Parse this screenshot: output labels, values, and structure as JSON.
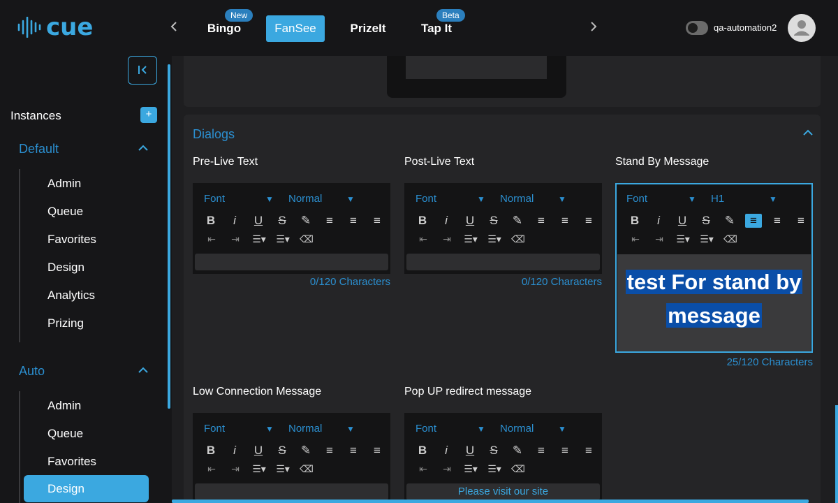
{
  "app": {
    "logo_text": "cue"
  },
  "header": {
    "tabs": [
      {
        "label": "Bingo",
        "badge": "New"
      },
      {
        "label": "FanSee",
        "badge": ""
      },
      {
        "label": "PrizeIt",
        "badge": ""
      },
      {
        "label": "Tap It",
        "badge": "Beta"
      }
    ],
    "active_tab": "FanSee",
    "username": "qa-automation2",
    "prev_icon": "chevron-left-icon",
    "next_icon": "chevron-right-icon"
  },
  "sidebar": {
    "instances_label": "Instances",
    "groups": [
      {
        "name": "Default",
        "items": [
          "Admin",
          "Queue",
          "Favorites",
          "Design",
          "Analytics",
          "Prizing"
        ]
      },
      {
        "name": "Auto",
        "items": [
          "Admin",
          "Queue",
          "Favorites",
          "Design"
        ]
      }
    ],
    "active_item": "Design"
  },
  "dialogs": {
    "title": "Dialogs",
    "fields": [
      {
        "label": "Pre-Live Text",
        "font": "Font",
        "size": "Normal",
        "counter": "0/120 Characters",
        "content": ""
      },
      {
        "label": "Post-Live Text",
        "font": "Font",
        "size": "Normal",
        "counter": "0/120 Characters",
        "content": ""
      },
      {
        "label": "Stand By Message",
        "font": "Font",
        "size": "H1",
        "counter": "25/120 Characters",
        "content_line1": "test For stand by",
        "content_line2": "message"
      },
      {
        "label": "Low Connection Message",
        "font": "Font",
        "size": "Normal",
        "counter": "",
        "content": ""
      },
      {
        "label": "Pop UP redirect message",
        "font": "Font",
        "size": "Normal",
        "counter": "",
        "content": "Please visit our site"
      }
    ]
  },
  "colors": {
    "accent": "#3ba8e0",
    "background": "#161618",
    "panel": "#252527",
    "selection": "#0a4ea8"
  }
}
